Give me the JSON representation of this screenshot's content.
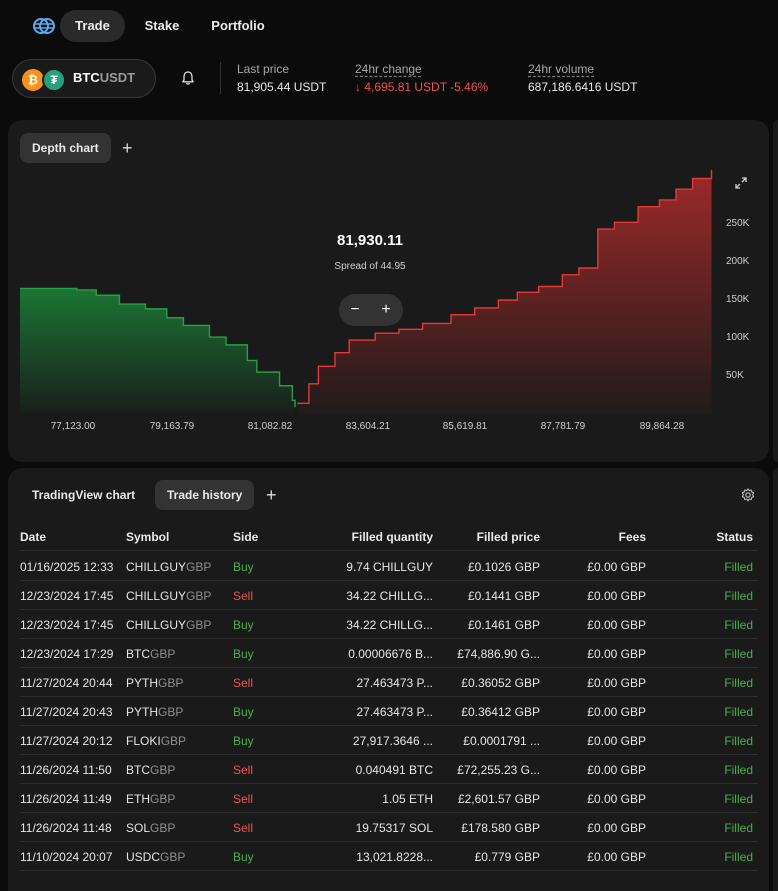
{
  "nav": {
    "tabs": [
      "Trade",
      "Stake",
      "Portfolio"
    ]
  },
  "pair": {
    "base": "BTC",
    "quote": "USDT",
    "base_icon": "bitcoin-icon",
    "quote_icon": "tether-icon"
  },
  "stats": {
    "last_price_label": "Last price",
    "last_price_value": "81,905.44 USDT",
    "change_label": "24hr change",
    "change_value": "↓ 4,695.81 USDT -5.46%",
    "volume_label": "24hr volume",
    "volume_value": "687,186.6416 USDT"
  },
  "colors": {
    "bid": "#26a045",
    "ask": "#e53935",
    "buy": "#4caf50",
    "sell": "#ef5350",
    "panel": "#1a1a1a"
  },
  "depth_panel": {
    "tab": "Depth chart",
    "mid_price": "81,930.11",
    "spread": "Spread of 44.95",
    "zoom_out": "−",
    "zoom_in": "+"
  },
  "chart_data": {
    "type": "area",
    "title": "",
    "x_ticks": [
      "77,123.00",
      "79,163.79",
      "81,082.82",
      "83,604.21",
      "85,619.81",
      "87,781.79",
      "89,864.28"
    ],
    "y_ticks": [
      "250K",
      "200K",
      "150K",
      "100K",
      "50K"
    ],
    "ylim": [
      0,
      260000
    ],
    "xlim": [
      76100,
      90900
    ],
    "series": [
      {
        "side": "bid",
        "x": [
          76100,
          76400,
          77300,
          77710,
          78200,
          78750,
          79200,
          79550,
          80100,
          80450,
          80900,
          81100,
          81580,
          81850,
          81907
        ],
        "y": [
          128000,
          128000,
          126500,
          121000,
          112000,
          107000,
          98000,
          90000,
          78000,
          70000,
          54000,
          42000,
          28000,
          13000,
          6000
        ]
      },
      {
        "side": "ask",
        "x": [
          81952,
          82200,
          82400,
          82750,
          83050,
          83600,
          84100,
          84600,
          85200,
          85700,
          86200,
          86600,
          87050,
          87550,
          87900,
          88300,
          88650,
          89150,
          89600,
          89950,
          90300,
          90700
        ],
        "y": [
          10000,
          30000,
          48000,
          62000,
          75000,
          82000,
          86000,
          92000,
          101000,
          108000,
          116000,
          124000,
          130000,
          142000,
          149000,
          189000,
          196000,
          212000,
          219000,
          230000,
          241000,
          250000
        ]
      }
    ]
  },
  "history_panel": {
    "tabs": [
      "TradingView chart",
      "Trade history"
    ],
    "columns": [
      "Date",
      "Symbol",
      "Side",
      "Filled quantity",
      "Filled price",
      "Fees",
      "Status"
    ],
    "rows": [
      {
        "date": "01/16/2025 12:33",
        "sym": "CHILLGUY",
        "quote": "GBP",
        "side": "Buy",
        "qty": "9.74 CHILLGUY",
        "price": "£0.1026 GBP",
        "fees": "£0.00 GBP",
        "status": "Filled"
      },
      {
        "date": "12/23/2024 17:45",
        "sym": "CHILLGUY",
        "quote": "GBP",
        "side": "Sell",
        "qty": "34.22 CHILLG...",
        "price": "£0.1441 GBP",
        "fees": "£0.00 GBP",
        "status": "Filled"
      },
      {
        "date": "12/23/2024 17:45",
        "sym": "CHILLGUY",
        "quote": "GBP",
        "side": "Buy",
        "qty": "34.22 CHILLG...",
        "price": "£0.1461 GBP",
        "fees": "£0.00 GBP",
        "status": "Filled"
      },
      {
        "date": "12/23/2024 17:29",
        "sym": "BTC",
        "quote": "GBP",
        "side": "Buy",
        "qty": "0.00006676 B...",
        "price": "£74,886.90 G...",
        "fees": "£0.00 GBP",
        "status": "Filled"
      },
      {
        "date": "11/27/2024 20:44",
        "sym": "PYTH",
        "quote": "GBP",
        "side": "Sell",
        "qty": "27.463473 P...",
        "price": "£0.36052 GBP",
        "fees": "£0.00 GBP",
        "status": "Filled"
      },
      {
        "date": "11/27/2024 20:43",
        "sym": "PYTH",
        "quote": "GBP",
        "side": "Buy",
        "qty": "27.463473 P...",
        "price": "£0.36412 GBP",
        "fees": "£0.00 GBP",
        "status": "Filled"
      },
      {
        "date": "11/27/2024 20:12",
        "sym": "FLOKI",
        "quote": "GBP",
        "side": "Buy",
        "qty": "27,917.3646 ...",
        "price": "£0.0001791 ...",
        "fees": "£0.00 GBP",
        "status": "Filled"
      },
      {
        "date": "11/26/2024 11:50",
        "sym": "BTC",
        "quote": "GBP",
        "side": "Sell",
        "qty": "0.040491 BTC",
        "price": "£72,255.23 G...",
        "fees": "£0.00 GBP",
        "status": "Filled"
      },
      {
        "date": "11/26/2024 11:49",
        "sym": "ETH",
        "quote": "GBP",
        "side": "Sell",
        "qty": "1.05 ETH",
        "price": "£2,601.57 GBP",
        "fees": "£0.00 GBP",
        "status": "Filled"
      },
      {
        "date": "11/26/2024 11:48",
        "sym": "SOL",
        "quote": "GBP",
        "side": "Sell",
        "qty": "19.75317 SOL",
        "price": "£178.580 GBP",
        "fees": "£0.00 GBP",
        "status": "Filled"
      },
      {
        "date": "11/10/2024 20:07",
        "sym": "USDC",
        "quote": "GBP",
        "side": "Buy",
        "qty": "13,021.8228...",
        "price": "£0.779 GBP",
        "fees": "£0.00 GBP",
        "status": "Filled"
      }
    ]
  }
}
